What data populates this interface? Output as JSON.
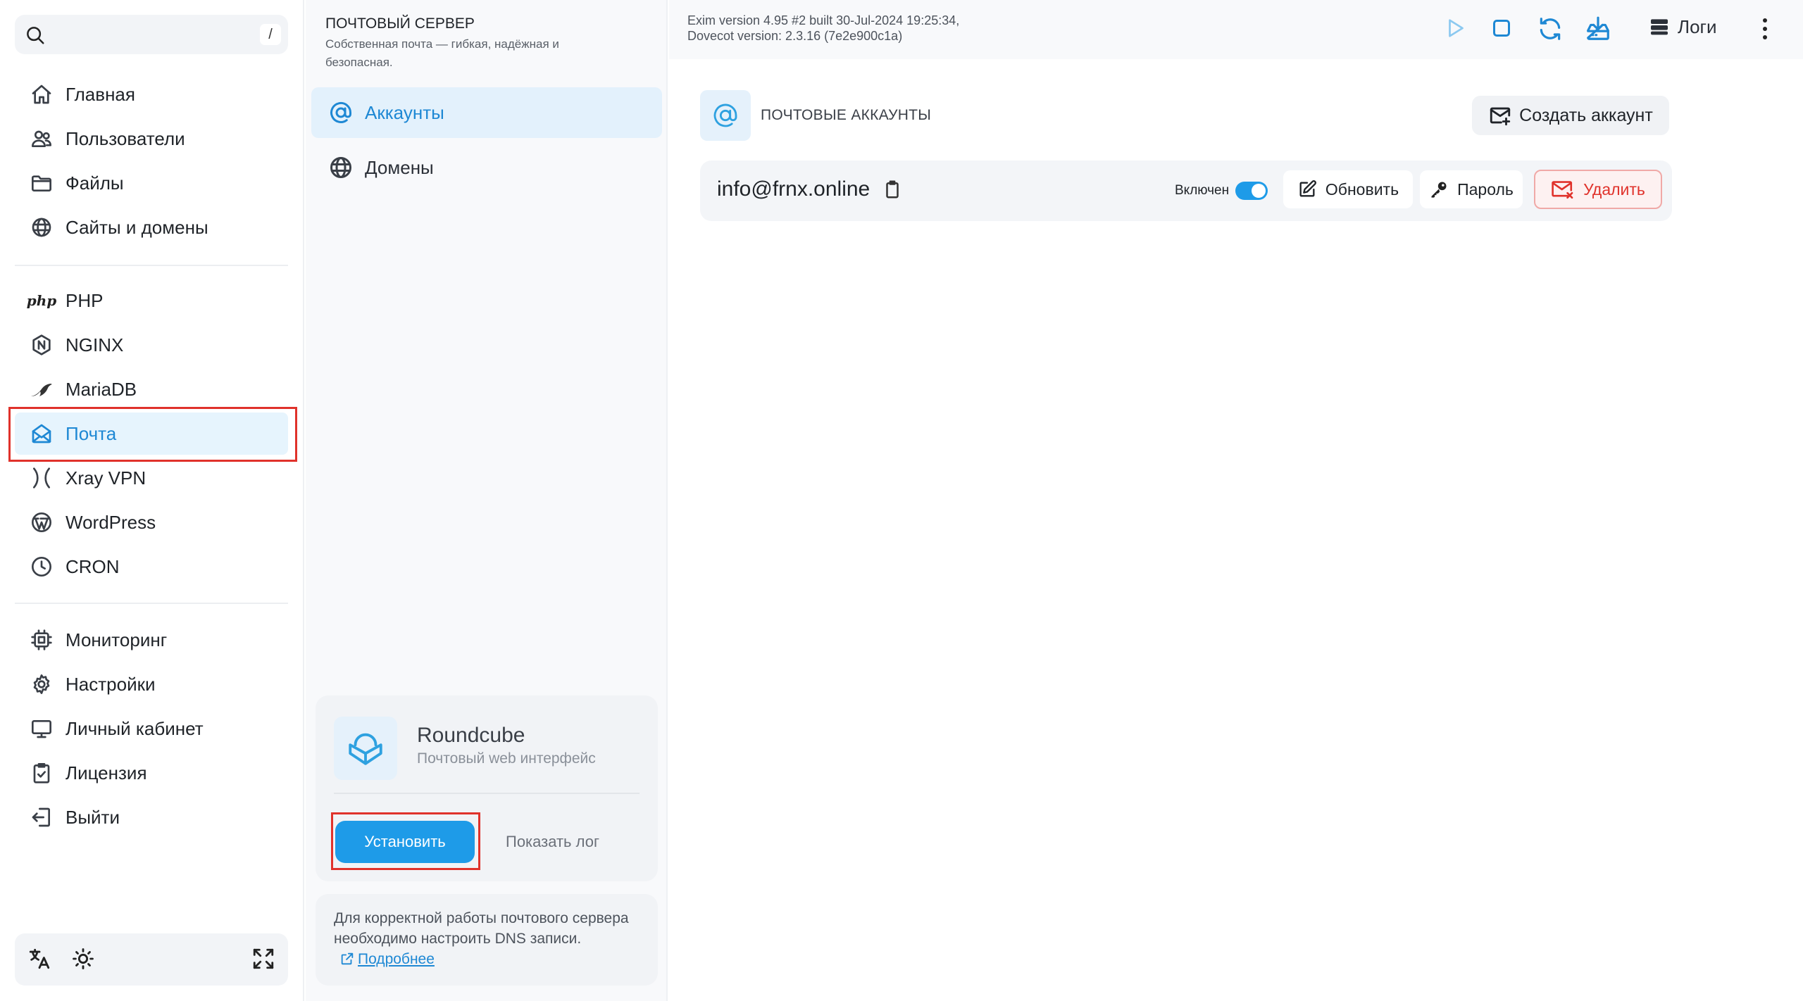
{
  "sidebar": {
    "search_kbd": "/",
    "groups": [
      [
        {
          "label": "Главная",
          "icon": "home-icon"
        },
        {
          "label": "Пользователи",
          "icon": "users-icon"
        },
        {
          "label": "Файлы",
          "icon": "folder-icon"
        },
        {
          "label": "Сайты и домены",
          "icon": "globe-icon"
        }
      ],
      [
        {
          "label": "PHP",
          "icon": "php-icon",
          "icon_text": "php"
        },
        {
          "label": "NGINX",
          "icon": "nginx-icon"
        },
        {
          "label": "MariaDB",
          "icon": "mariadb-icon"
        },
        {
          "label": "Почта",
          "icon": "mail-icon",
          "active": true
        },
        {
          "label": "Xray VPN",
          "icon": "xray-icon"
        },
        {
          "label": "WordPress",
          "icon": "wordpress-icon"
        },
        {
          "label": "CRON",
          "icon": "clock-icon"
        }
      ],
      [
        {
          "label": "Мониторинг",
          "icon": "cpu-icon"
        },
        {
          "label": "Настройки",
          "icon": "gear-icon"
        },
        {
          "label": "Личный кабинет",
          "icon": "monitor-icon"
        },
        {
          "label": "Лицензия",
          "icon": "license-icon"
        },
        {
          "label": "Выйти",
          "icon": "logout-icon"
        }
      ]
    ]
  },
  "panel": {
    "title": "ПОЧТОВЫЙ СЕРВЕР",
    "description": "Собственная почта — гибкая, надёжная и безопасная.",
    "nav": [
      {
        "label": "Аккаунты",
        "icon": "at-icon",
        "active": true
      },
      {
        "label": "Домены",
        "icon": "globe-icon"
      }
    ],
    "roundcube": {
      "name": "Roundcube",
      "subtitle": "Почтовый web интерфейс",
      "install_label": "Установить",
      "show_log_label": "Показать лог"
    },
    "dns_note": {
      "text": "Для корректной работы почтового сервера необходимо настроить DNS записи.",
      "link_label": "Подробнее"
    }
  },
  "topbar": {
    "version_line1": "Exim version 4.95 #2 built 30-Jul-2024 19:25:34,",
    "version_line2": "Dovecot version: 2.3.16 (7e2e900c1a)",
    "logs_label": "Логи"
  },
  "accounts": {
    "title": "ПОЧТОВЫЕ АККАУНТЫ",
    "create_label": "Создать аккаунт",
    "rows": [
      {
        "email": "info@frnx.online",
        "enabled_label": "Включен",
        "enabled": true,
        "update_label": "Обновить",
        "password_label": "Пароль",
        "delete_label": "Удалить"
      }
    ]
  },
  "colors": {
    "accent": "#1e9be8",
    "active_bg": "#e6f4fd",
    "danger": "#e0322b"
  }
}
